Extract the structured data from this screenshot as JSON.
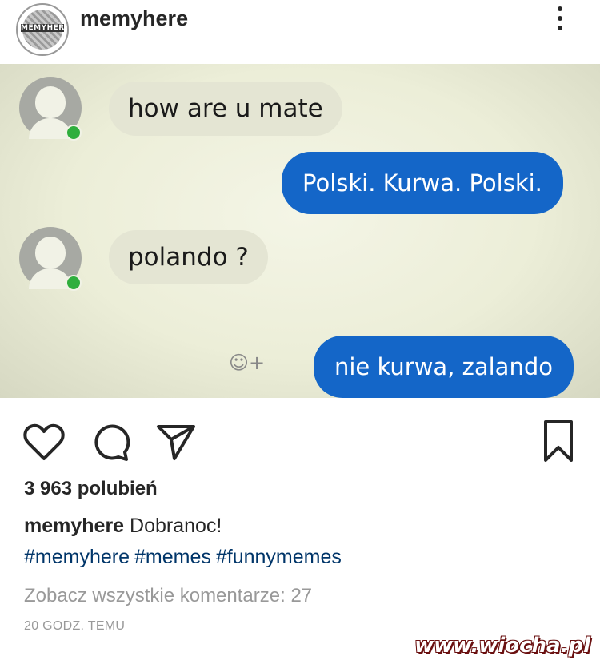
{
  "post": {
    "username": "memyhere",
    "avatar_label": "MEMYHERE",
    "messages": [
      {
        "from": "them",
        "text": "how are u mate"
      },
      {
        "from": "me",
        "text": "Polski. Kurwa. Polski."
      },
      {
        "from": "them",
        "text": "polando ?"
      },
      {
        "from": "me",
        "text": "nie kurwa, zalando"
      }
    ],
    "emoji_add": "☺+",
    "likes": "3 963 polubień",
    "caption_user": "memyhere",
    "caption_text": " Dobranoc!",
    "hashtags": [
      "#memyhere",
      "#memes",
      "#funnymemes"
    ],
    "comments_link": "Zobacz wszystkie komentarze: 27",
    "timestamp": "20 GODZ. TEMU",
    "watermark": "www.wiocha.pl"
  },
  "icons": [
    "more-icon",
    "heart-icon",
    "comment-icon",
    "share-icon",
    "bookmark-icon"
  ],
  "colors": {
    "link": "#003569",
    "bubble_out": "#1466c8",
    "bubble_in": "#e4e5d3",
    "online": "#2fae3d"
  }
}
